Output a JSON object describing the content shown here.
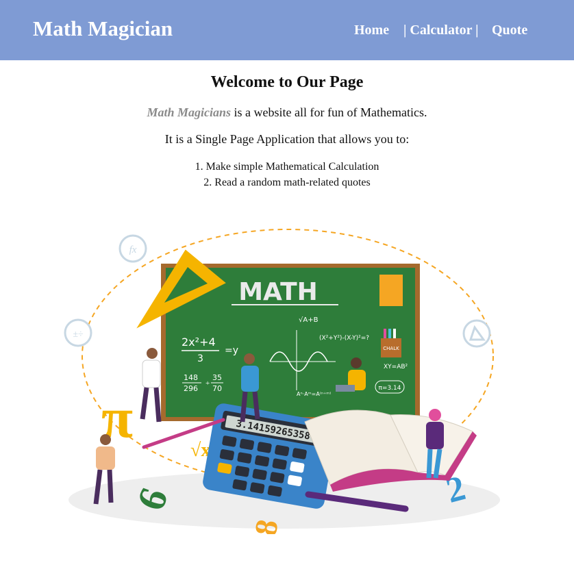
{
  "header": {
    "brand": "Math Magician",
    "nav": {
      "home": "Home",
      "calculator": "| Calculator |",
      "quote": "Quote"
    }
  },
  "main": {
    "title": "Welcome to Our Page",
    "intro_highlight": "Math Magicians",
    "intro_rest": " is a website all for fun of Mathematics.",
    "subtitle": "It is a Single Page Application that allows you to:",
    "features": [
      "1. Make simple Mathematical Calculation",
      "2. Read a random math-related quotes"
    ]
  },
  "illustration": {
    "board_title": "MATH",
    "calculator_display": "3.14159265358",
    "formula_1": "2x²+4",
    "formula_1_den": "3",
    "formula_1_eq": "=y",
    "fraction_1_num": "148",
    "fraction_1_den": "296",
    "fraction_2_num": "35",
    "fraction_2_den": "70",
    "sqrt_text": "√A+B",
    "identity": "(X²+Y²)-(X-Y)²=?",
    "power_rule": "Aⁿ·Aᵐ=A⁽ⁿ⁺ᵐ⁾",
    "pi_value": "π=3.14",
    "xy_text": "XY=AB²",
    "chalk_label": "CHALK",
    "pi_symbol": "π",
    "sqrt_symbol": "√x",
    "digit_6": "6",
    "digit_8": "8",
    "digit_2": "2",
    "fx_icon": "fx",
    "accent_orange": "#f5a623",
    "board_green": "#2e7d3a"
  }
}
